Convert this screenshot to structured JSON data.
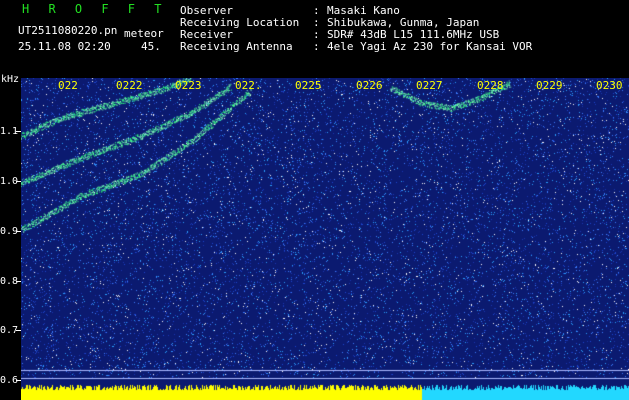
{
  "header": {
    "app_name": "H R O F F T",
    "file_name": "UT2511080220.pn",
    "mode": "meteor",
    "datetime": "25.11.08 02:20",
    "value": "45.",
    "fields": [
      {
        "label": "Observer",
        "sep": ":",
        "value": "Masaki Kano"
      },
      {
        "label": "Receiving Location",
        "sep": ":",
        "value": "Shibukawa, Gunma, Japan"
      },
      {
        "label": "Receiver",
        "sep": ":",
        "value": "SDR# 43dB L15 111.6MHz USB"
      },
      {
        "label": "Receiving Antenna",
        "sep": ":",
        "value": "4ele Yagi Az 230 for Kansai VOR"
      }
    ]
  },
  "spectrogram": {
    "y_unit": "kHz",
    "y_ticks": [
      "1.1",
      "1.0",
      "0.9",
      "0.8",
      "0.7",
      "0.6"
    ],
    "time_ticks": [
      "022",
      "0222",
      "0223",
      "022.",
      "0225",
      "0226",
      "0227",
      "0228",
      "0229",
      "0230"
    ],
    "colors": {
      "background": "#0b1a70",
      "noise_low": "#1e46d0",
      "noise_high": "#2aa0ff",
      "signal": "#30ff80",
      "baseline": "#ffff00",
      "baseline_alt": "#22d8ff"
    }
  }
}
